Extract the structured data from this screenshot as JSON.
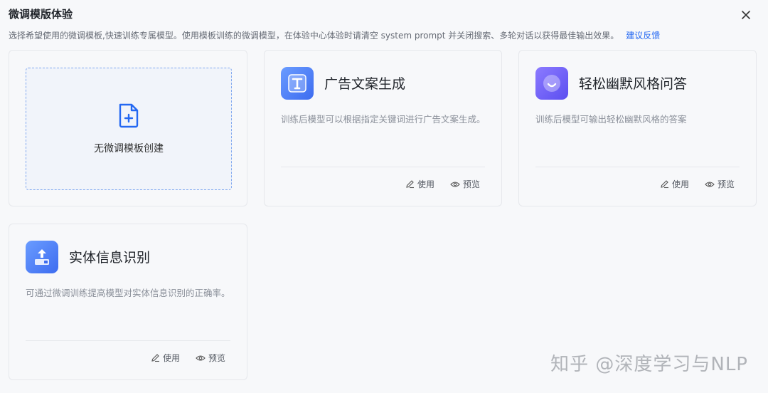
{
  "dialog": {
    "title": "微调模版体验",
    "subtitle": "选择希望使用的微调模板,快速训练专属模型。使用模板训练的微调模型，在体验中心体验时请清空 system prompt 并关闭搜索、多轮对话以获得最佳输出效果。",
    "feedback_link": "建议反馈",
    "close_icon": "close-icon"
  },
  "create_card": {
    "label": "无微调模板创建",
    "icon": "add-file-icon"
  },
  "templates": [
    {
      "name": "广告文案生成",
      "desc": "训练后模型可以根据指定关键词进行广告文案生成。",
      "icon": "text-t-icon",
      "use_label": "使用",
      "preview_label": "预览"
    },
    {
      "name": "轻松幽默风格问答",
      "desc": "训练后模型可输出轻松幽默风格的答案",
      "icon": "smile-icon",
      "use_label": "使用",
      "preview_label": "预览"
    },
    {
      "name": "实体信息识别",
      "desc": "可通过微调训练提高模型对实体信息识别的正确率。",
      "icon": "upload-entity-icon",
      "use_label": "使用",
      "preview_label": "预览"
    }
  ],
  "watermark": "知乎 @深度学习与NLP",
  "colors": {
    "accent": "#2468f2",
    "dashed_border": "#7fa7f0"
  }
}
